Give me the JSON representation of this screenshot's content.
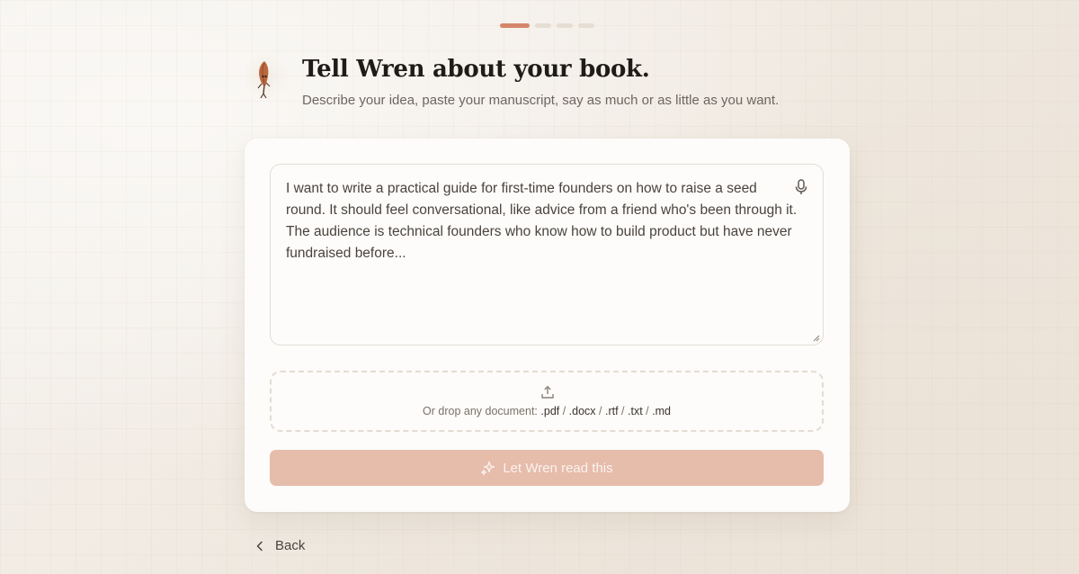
{
  "progress": {
    "total_steps": 4,
    "current_step": 1
  },
  "header": {
    "title": "Tell Wren about your book.",
    "subtitle": "Describe your idea, paste your manuscript, say as much or as little as you want."
  },
  "editor": {
    "text": "I want to write a practical guide for first-time founders on how to raise a seed round. It should feel conversational, like advice from a friend who's been through it. The audience is technical founders who know how to build product but have never fundraised before..."
  },
  "dropzone": {
    "prefix": "Or drop any document:",
    "formats": [
      ".pdf",
      ".docx",
      ".rtf",
      ".txt",
      ".md"
    ],
    "separator": " / "
  },
  "cta": {
    "label": "Let Wren read this"
  },
  "nav": {
    "back_label": "Back"
  },
  "icons": {
    "mascot": "quill-character-icon",
    "mic": "microphone-icon",
    "upload": "upload-icon",
    "sparkle": "sparkles-icon",
    "back": "chevron-left-icon"
  },
  "colors": {
    "accent": "#d5866b",
    "cta_bg": "#e6bcab",
    "step_idle": "#e6ddd3"
  }
}
